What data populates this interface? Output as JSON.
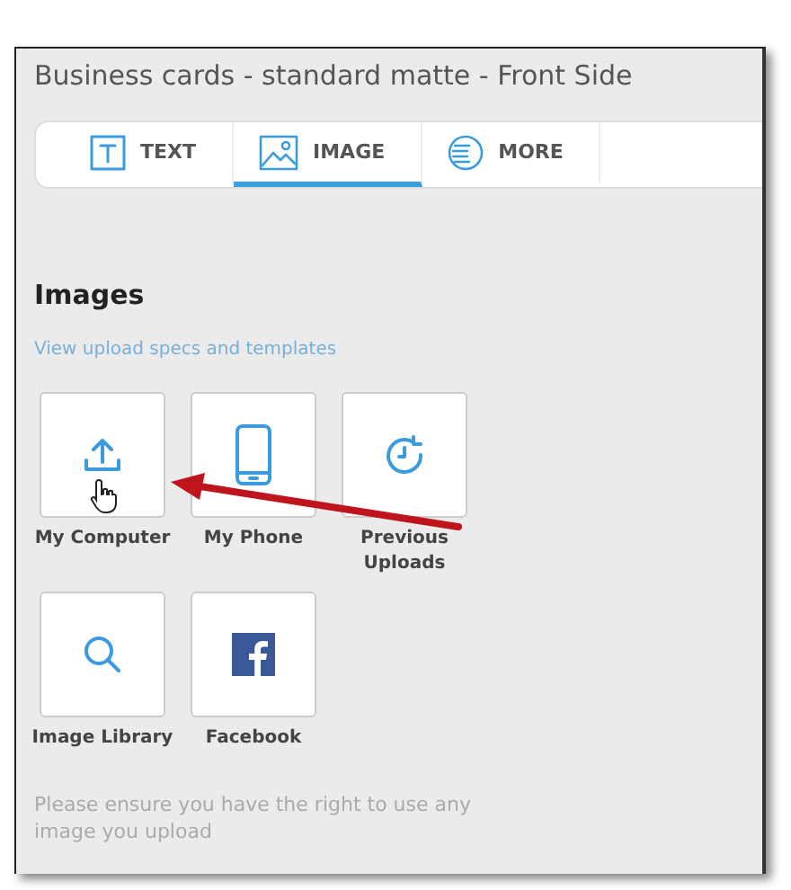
{
  "window": {
    "title": "Business cards - standard matte - Front Side"
  },
  "tabs": [
    {
      "label": "TEXT",
      "kind": "text",
      "selected": false
    },
    {
      "label": "IMAGE",
      "kind": "image",
      "selected": true
    },
    {
      "label": "MORE",
      "kind": "more",
      "selected": false
    }
  ],
  "section": {
    "heading": "Images",
    "link": "View upload specs and templates"
  },
  "sources": [
    {
      "label": "My Computer",
      "kind": "upload"
    },
    {
      "label": "My Phone",
      "kind": "phone"
    },
    {
      "label": "Previous Uploads",
      "kind": "history"
    },
    {
      "label": "Image Library",
      "kind": "search"
    },
    {
      "label": "Facebook",
      "kind": "facebook"
    }
  ],
  "footer": "Please ensure you have the right to use any image you upload"
}
